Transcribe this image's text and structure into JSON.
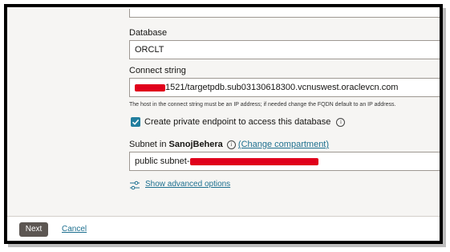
{
  "database": {
    "label": "Database",
    "value": "ORCLT"
  },
  "connect_string": {
    "label": "Connect string",
    "value_visible": "1521/targetpdb.sub03130618300.vcnuswest.oraclevcn.com",
    "help": "The host in the connect string must be an IP address; if needed change the FQDN default to an IP address."
  },
  "private_endpoint": {
    "label": "Create private endpoint to access this database",
    "checked": true
  },
  "subnet": {
    "label_prefix": "Subnet in",
    "compartment": "SanojBehera",
    "change_link": "(Change compartment)",
    "value_visible": "public subnet-"
  },
  "advanced_link": "Show advanced options",
  "footer": {
    "next": "Next",
    "cancel": "Cancel"
  },
  "colors": {
    "accent": "#227e9e",
    "link": "#1d6f8f",
    "redaction": "#e0001b",
    "primary_button": "#5c5652"
  }
}
